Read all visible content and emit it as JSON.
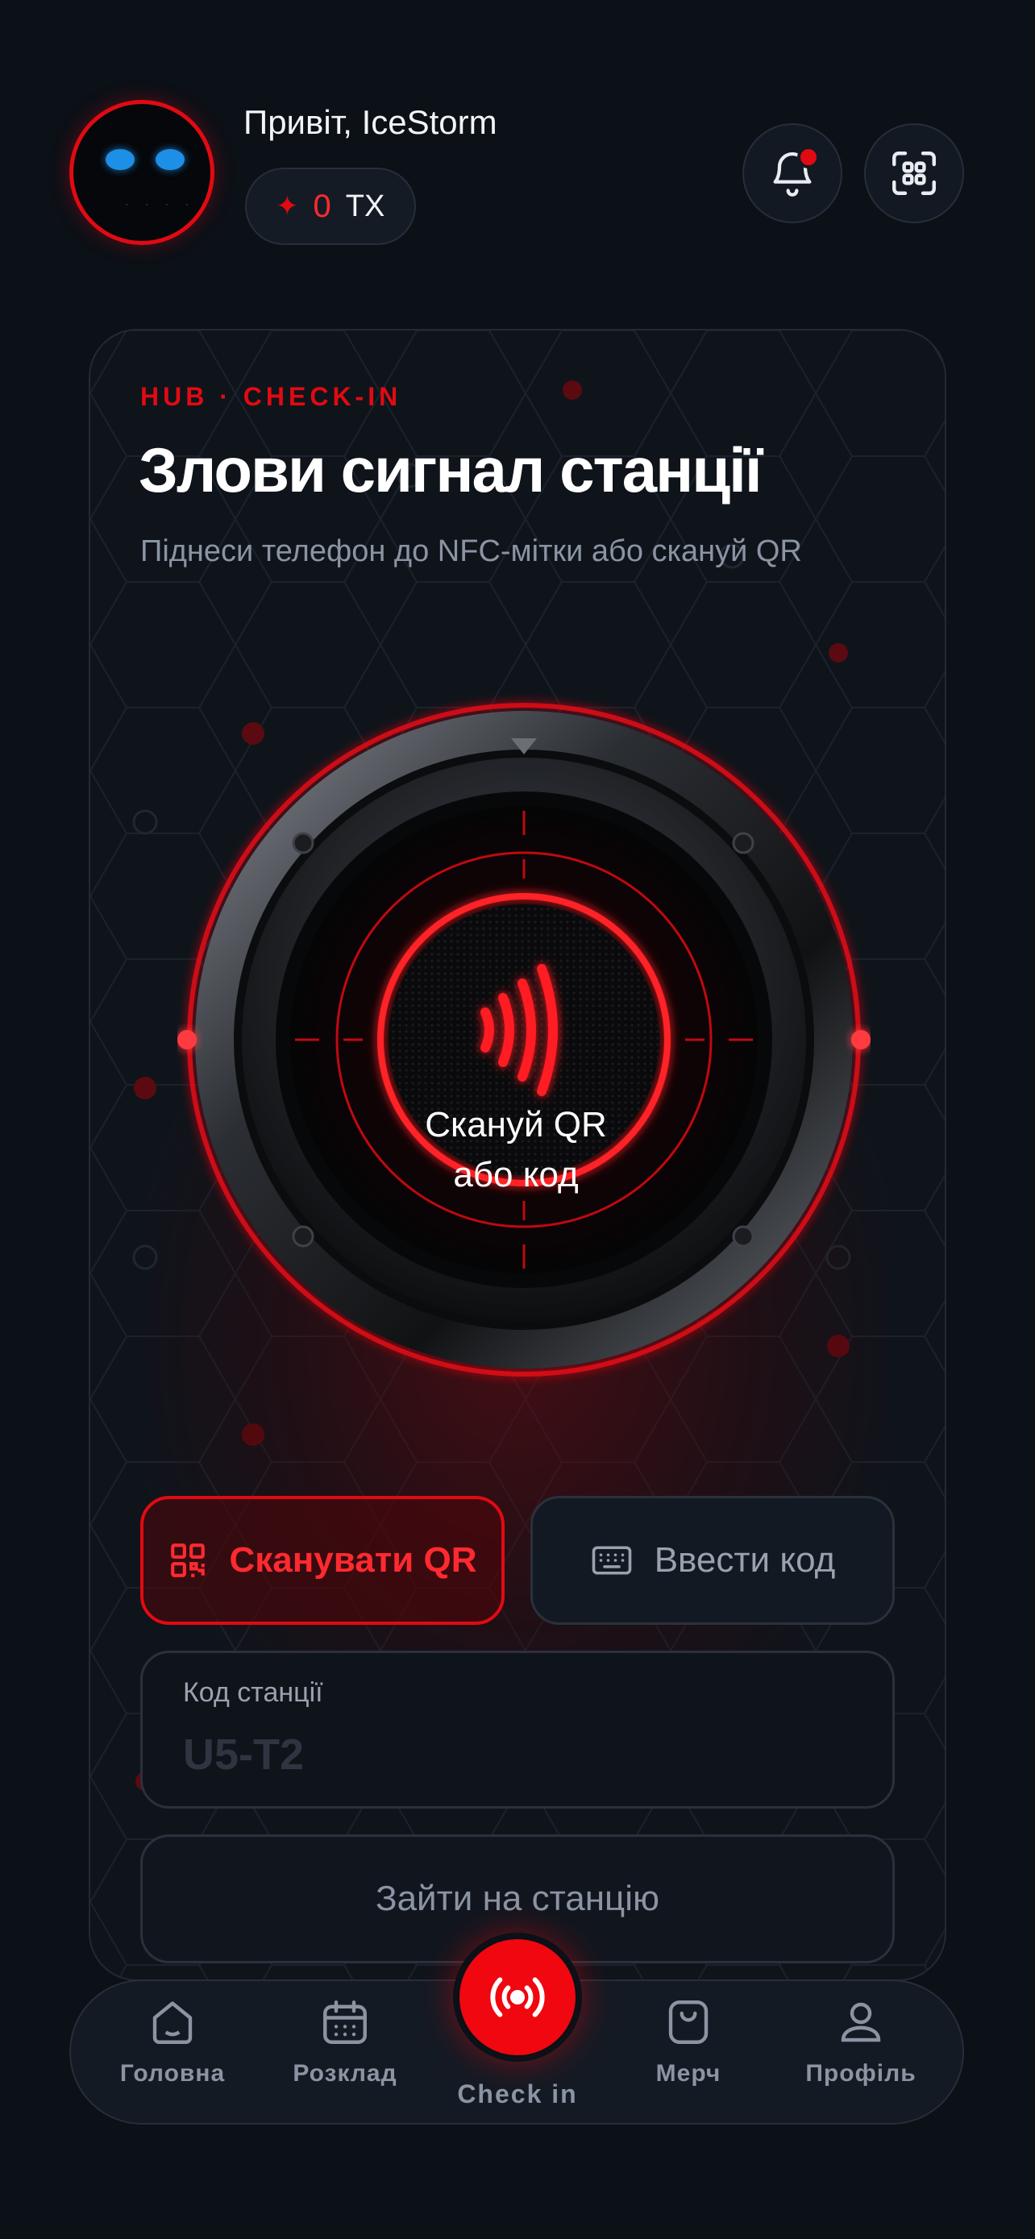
{
  "header": {
    "greeting": "Привіт, IceStorm",
    "token_count": "0",
    "token_unit": "TX",
    "notification_badge": true
  },
  "card": {
    "eyebrow": "HUB · CHECK-IN",
    "title": "Злови сигнал станції",
    "subtitle": "Піднеси телефон до NFC-мітки або скануй QR",
    "dial_line1": "Скануй QR",
    "dial_line2": "або код"
  },
  "actions": {
    "scan_qr_label": "Сканувати QR",
    "enter_code_label": "Ввести код"
  },
  "station_field": {
    "label": "Код станції",
    "value": "",
    "placeholder": "U5-T2"
  },
  "submit_label": "Зайти на станцію",
  "tabbar": {
    "home": "Головна",
    "schedule": "Розклад",
    "checkin": "Check in",
    "merch": "Мерч",
    "profile": "Профіль",
    "active": "checkin"
  },
  "colors": {
    "accent": "#e10a12",
    "background": "#0c1017",
    "muted_text": "#8b94a3"
  },
  "icons": [
    "robot-avatar",
    "sparkle-icon",
    "bell-icon",
    "qr-scan-icon",
    "nfc-icon",
    "qr-code-icon",
    "keyboard-icon",
    "home-icon",
    "calendar-icon",
    "broadcast-icon",
    "bag-icon",
    "user-icon"
  ]
}
